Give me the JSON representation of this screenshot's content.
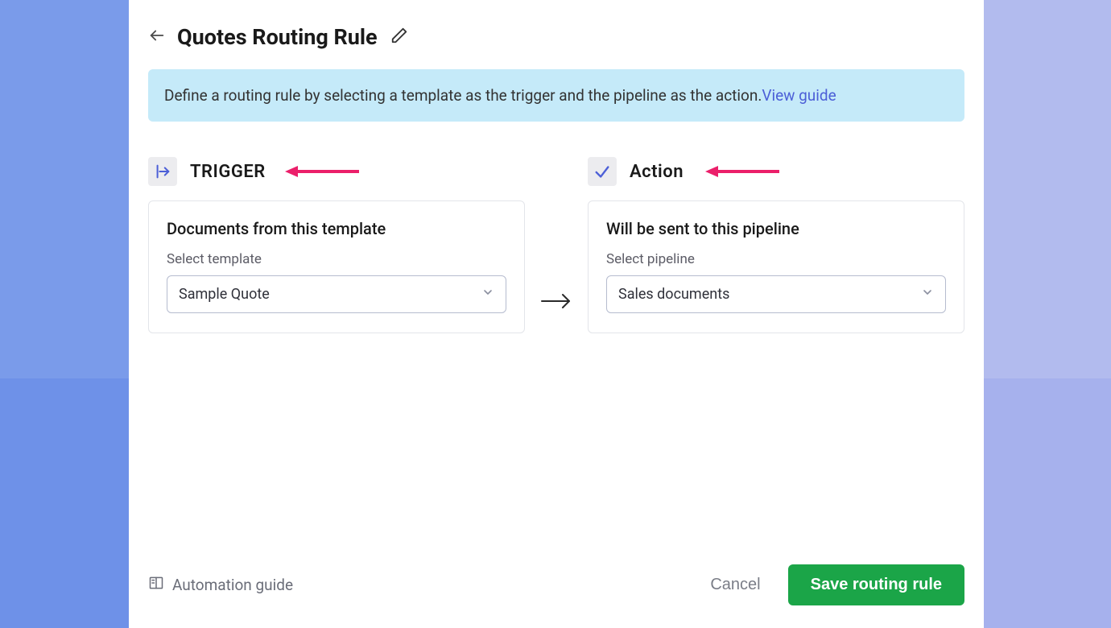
{
  "header": {
    "title": "Quotes Routing Rule"
  },
  "banner": {
    "text": "Define a routing rule by selecting a template as the trigger and the pipeline as the action.",
    "link_label": "View guide"
  },
  "trigger": {
    "label": "TRIGGER",
    "card_title": "Documents from this template",
    "field_label": "Select template",
    "selected": "Sample Quote"
  },
  "action": {
    "label": "Action",
    "card_title": "Will be sent to this pipeline",
    "field_label": "Select pipeline",
    "selected": "Sales documents"
  },
  "footer": {
    "guide_label": "Automation guide",
    "cancel_label": "Cancel",
    "save_label": "Save routing rule"
  },
  "colors": {
    "accent": "#4c5fd7",
    "save_bg": "#1ba548",
    "banner_bg": "#c5eaf9",
    "annotation": "#eb1f6a"
  }
}
